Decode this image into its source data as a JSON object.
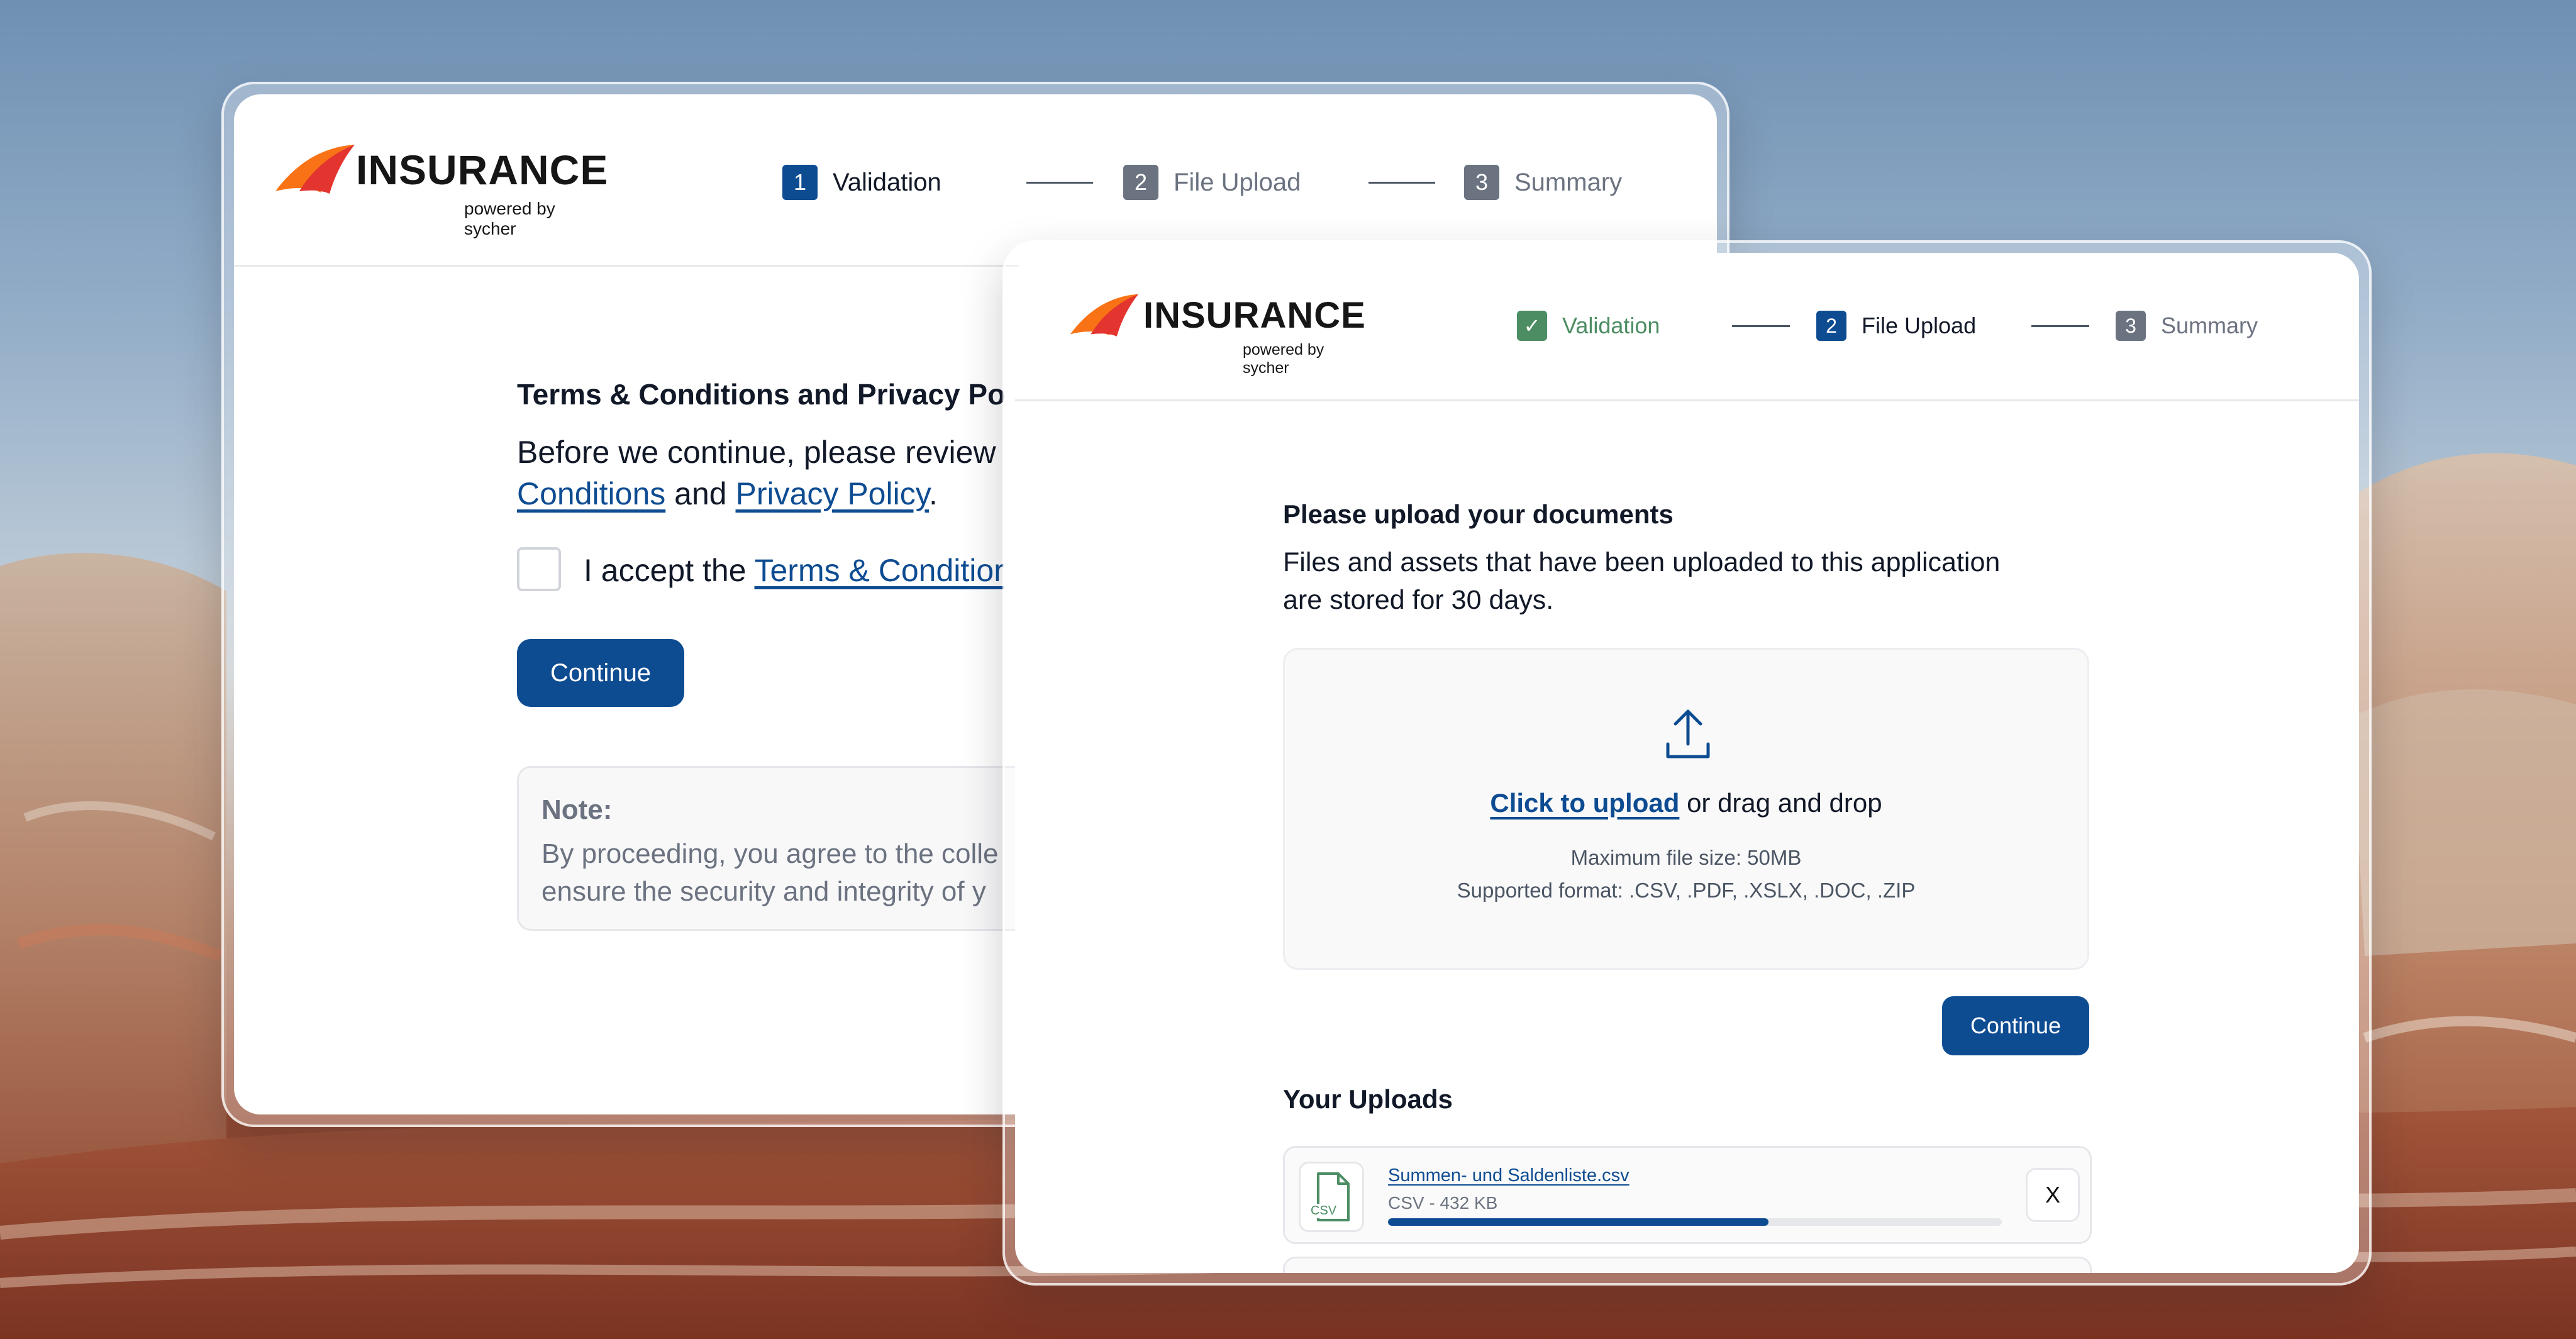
{
  "brand": {
    "name": "INSURANCE",
    "tagline": "powered by sycher",
    "colors": {
      "flame_orange": "#f97316",
      "flame_red": "#e3342f",
      "primary": "#0e4c92",
      "done_green": "#4c8d63"
    }
  },
  "window_back": {
    "steps": [
      {
        "number": "1",
        "label": "Validation",
        "state": "active"
      },
      {
        "number": "2",
        "label": "File Upload",
        "state": "idle"
      },
      {
        "number": "3",
        "label": "Summary",
        "state": "idle"
      }
    ],
    "heading": "Terms & Conditions and Privacy Po",
    "intro_text": "Before we continue, please review",
    "conditions_link": "Conditions",
    "and_text": "and",
    "privacy_link": "Privacy Policy",
    "period": ".",
    "accept_text": "I accept the",
    "accept_link": "Terms & Conditior",
    "continue_label": "Continue",
    "note_title": "Note:",
    "note_line1": "By proceeding, you agree to the colle",
    "note_line2": "ensure the security and integrity of y"
  },
  "window_front": {
    "steps": [
      {
        "number": "✓",
        "label": "Validation",
        "state": "done"
      },
      {
        "number": "2",
        "label": "File Upload",
        "state": "active"
      },
      {
        "number": "3",
        "label": "Summary",
        "state": "idle"
      }
    ],
    "heading": "Please upload your documents",
    "description_line1": "Files and assets that have been uploaded to this application",
    "description_line2": "are stored for 30 days.",
    "dropzone": {
      "icon": "upload-icon",
      "click_label": "Click to upload",
      "drag_text": "or drag and drop",
      "max_size": "Maximum file size: 50MB",
      "formats": "Supported format: .CSV, .PDF, .XSLX, .DOC, .ZIP"
    },
    "continue_label": "Continue",
    "uploads_title": "Your Uploads",
    "uploads": [
      {
        "file_icon_label": "CSV",
        "file_name": "Summen- und Saldenliste.csv",
        "meta": "CSV - 432 KB",
        "progress": 0.62,
        "remove_label": "X"
      }
    ]
  }
}
